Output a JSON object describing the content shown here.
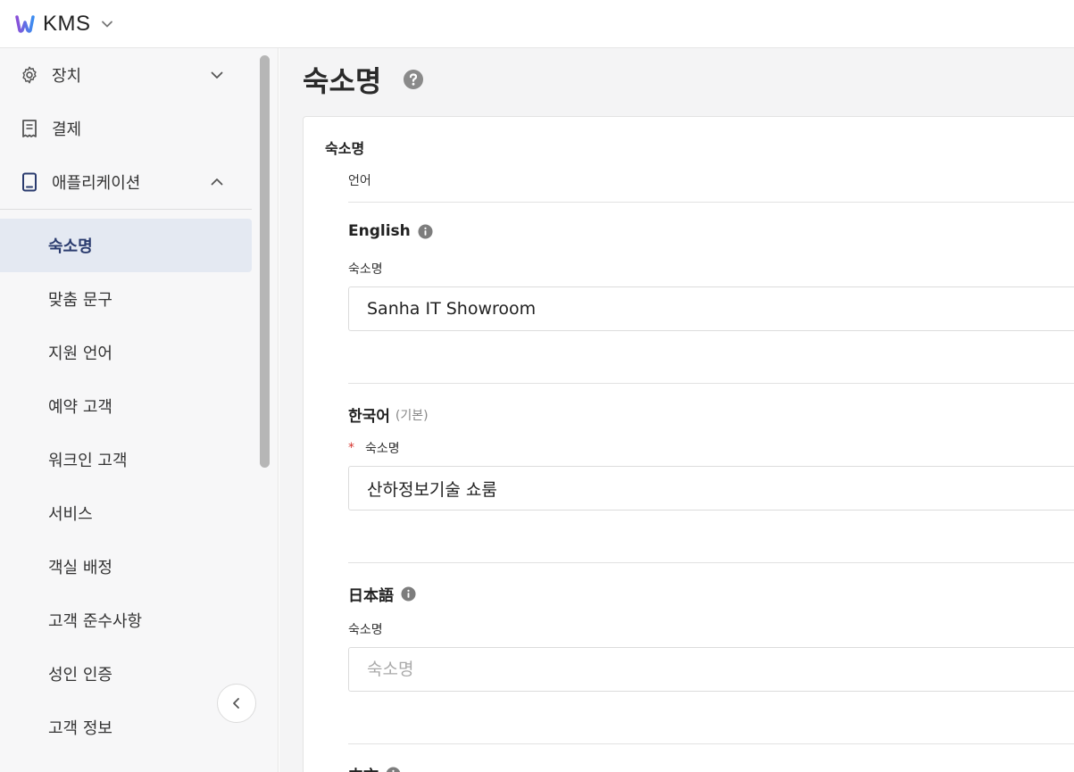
{
  "app": {
    "name": "KMS"
  },
  "sidebar": {
    "groups": [
      {
        "label": "장치",
        "icon": "gear-icon",
        "expanded": false
      },
      {
        "label": "결제",
        "icon": "receipt-icon"
      },
      {
        "label": "애플리케이션",
        "icon": "tablet-icon",
        "expanded": true
      }
    ],
    "items": [
      {
        "label": "숙소명",
        "active": true
      },
      {
        "label": "맞춤 문구"
      },
      {
        "label": "지원 언어"
      },
      {
        "label": "예약 고객"
      },
      {
        "label": "워크인 고객"
      },
      {
        "label": "서비스"
      },
      {
        "label": "객실 배정"
      },
      {
        "label": "고객 준수사항"
      },
      {
        "label": "성인 인증"
      },
      {
        "label": "고객 정보"
      }
    ]
  },
  "page": {
    "title": "숙소명"
  },
  "card": {
    "title": "숙소명",
    "column_label": "언어",
    "languages": [
      {
        "name": "English",
        "field_label": "숙소명",
        "value": "Sanha IT Showroom",
        "placeholder": "숙소명"
      },
      {
        "name": "한국어",
        "suffix": "(기본)",
        "required": "*",
        "field_label": "숙소명",
        "value": "산하정보기술 쇼룸",
        "placeholder": "숙소명"
      },
      {
        "name": "日本語",
        "field_label": "숙소명",
        "value": "",
        "placeholder": "숙소명"
      },
      {
        "name": "中文"
      }
    ]
  },
  "colors": {
    "accent": "#2a3b6e",
    "active_bg": "#e4e9f2",
    "required": "#d6352f"
  }
}
